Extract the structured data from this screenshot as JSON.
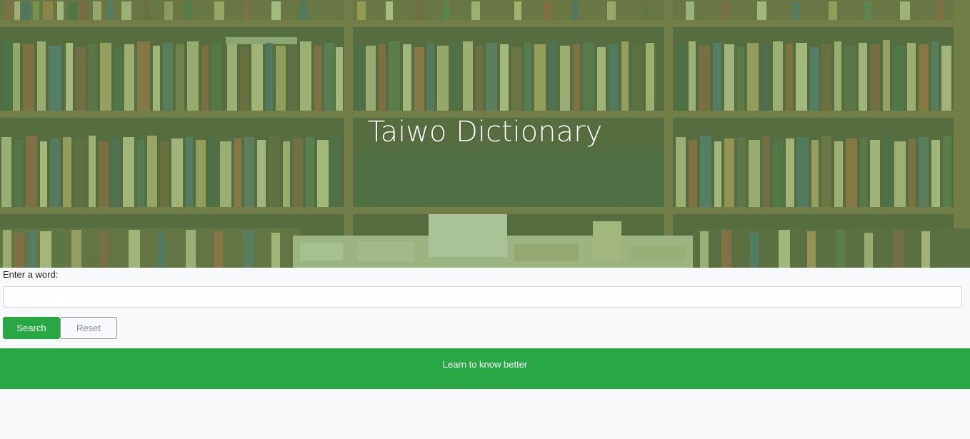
{
  "hero": {
    "title": "Taiwo Dictionary",
    "background_image": "bookshelf-photo"
  },
  "search_form": {
    "label": "Enter a word:",
    "input_value": "",
    "input_placeholder": "",
    "search_label": "Search",
    "reset_label": "Reset"
  },
  "banner": {
    "text": "Learn to know better"
  },
  "colors": {
    "accent": "#28a745",
    "hero_tint": "#76aa60",
    "page_bg": "#f8f9fa"
  }
}
